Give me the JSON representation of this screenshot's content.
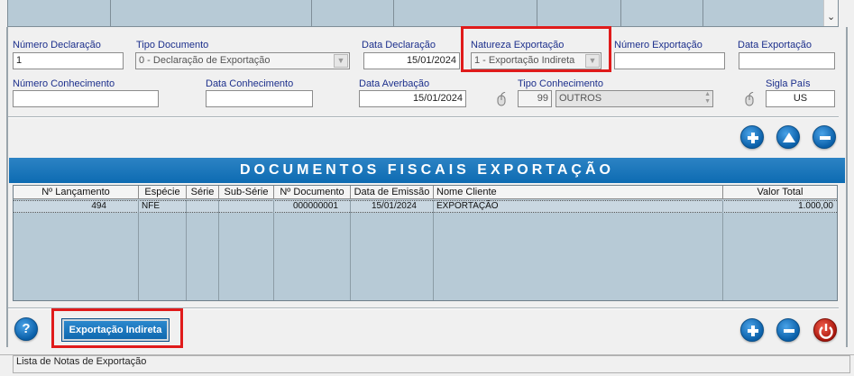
{
  "form": {
    "numero_declaracao": {
      "label": "Número Declaração",
      "value": "1"
    },
    "tipo_documento": {
      "label": "Tipo Documento",
      "value": "0 - Declaração de Exportação"
    },
    "data_declaracao": {
      "label": "Data Declaração",
      "value": "15/01/2024"
    },
    "natureza_exportacao": {
      "label": "Natureza Exportação",
      "value": "1 - Exportação Indireta"
    },
    "numero_exportacao": {
      "label": "Número Exportação",
      "value": ""
    },
    "data_exportacao": {
      "label": "Data Exportação",
      "value": ""
    },
    "numero_conhecimento": {
      "label": "Número Conhecimento",
      "value": ""
    },
    "data_conhecimento": {
      "label": "Data Conhecimento",
      "value": ""
    },
    "data_averbacao": {
      "label": "Data Averbação",
      "value": "15/01/2024"
    },
    "tipo_conhecimento": {
      "label": "Tipo Conhecimento",
      "code": "99",
      "description": "OUTROS"
    },
    "sigla_pais": {
      "label": "Sigla País",
      "value": "US"
    }
  },
  "section": {
    "title": "DOCUMENTOS FISCAIS EXPORTAÇÃO"
  },
  "table": {
    "columns": [
      "Nº Lançamento",
      "Espécie",
      "Série",
      "Sub-Série",
      "Nº Documento",
      "Data de Emissão",
      "Nome Cliente",
      "Valor Total"
    ],
    "rows": [
      [
        "494",
        "NFE",
        "",
        "",
        "000000001",
        "15/01/2024",
        "EXPORTAÇÃO",
        "1.000,00"
      ]
    ]
  },
  "buttons": {
    "exportacao_indireta": "Exportação Indireta",
    "help": "?"
  },
  "status": {
    "text": "Lista de Notas de Exportação"
  },
  "colors": {
    "accent": "#0d6bb2",
    "highlight": "#e01b1b",
    "grid": "#b7cad6"
  }
}
